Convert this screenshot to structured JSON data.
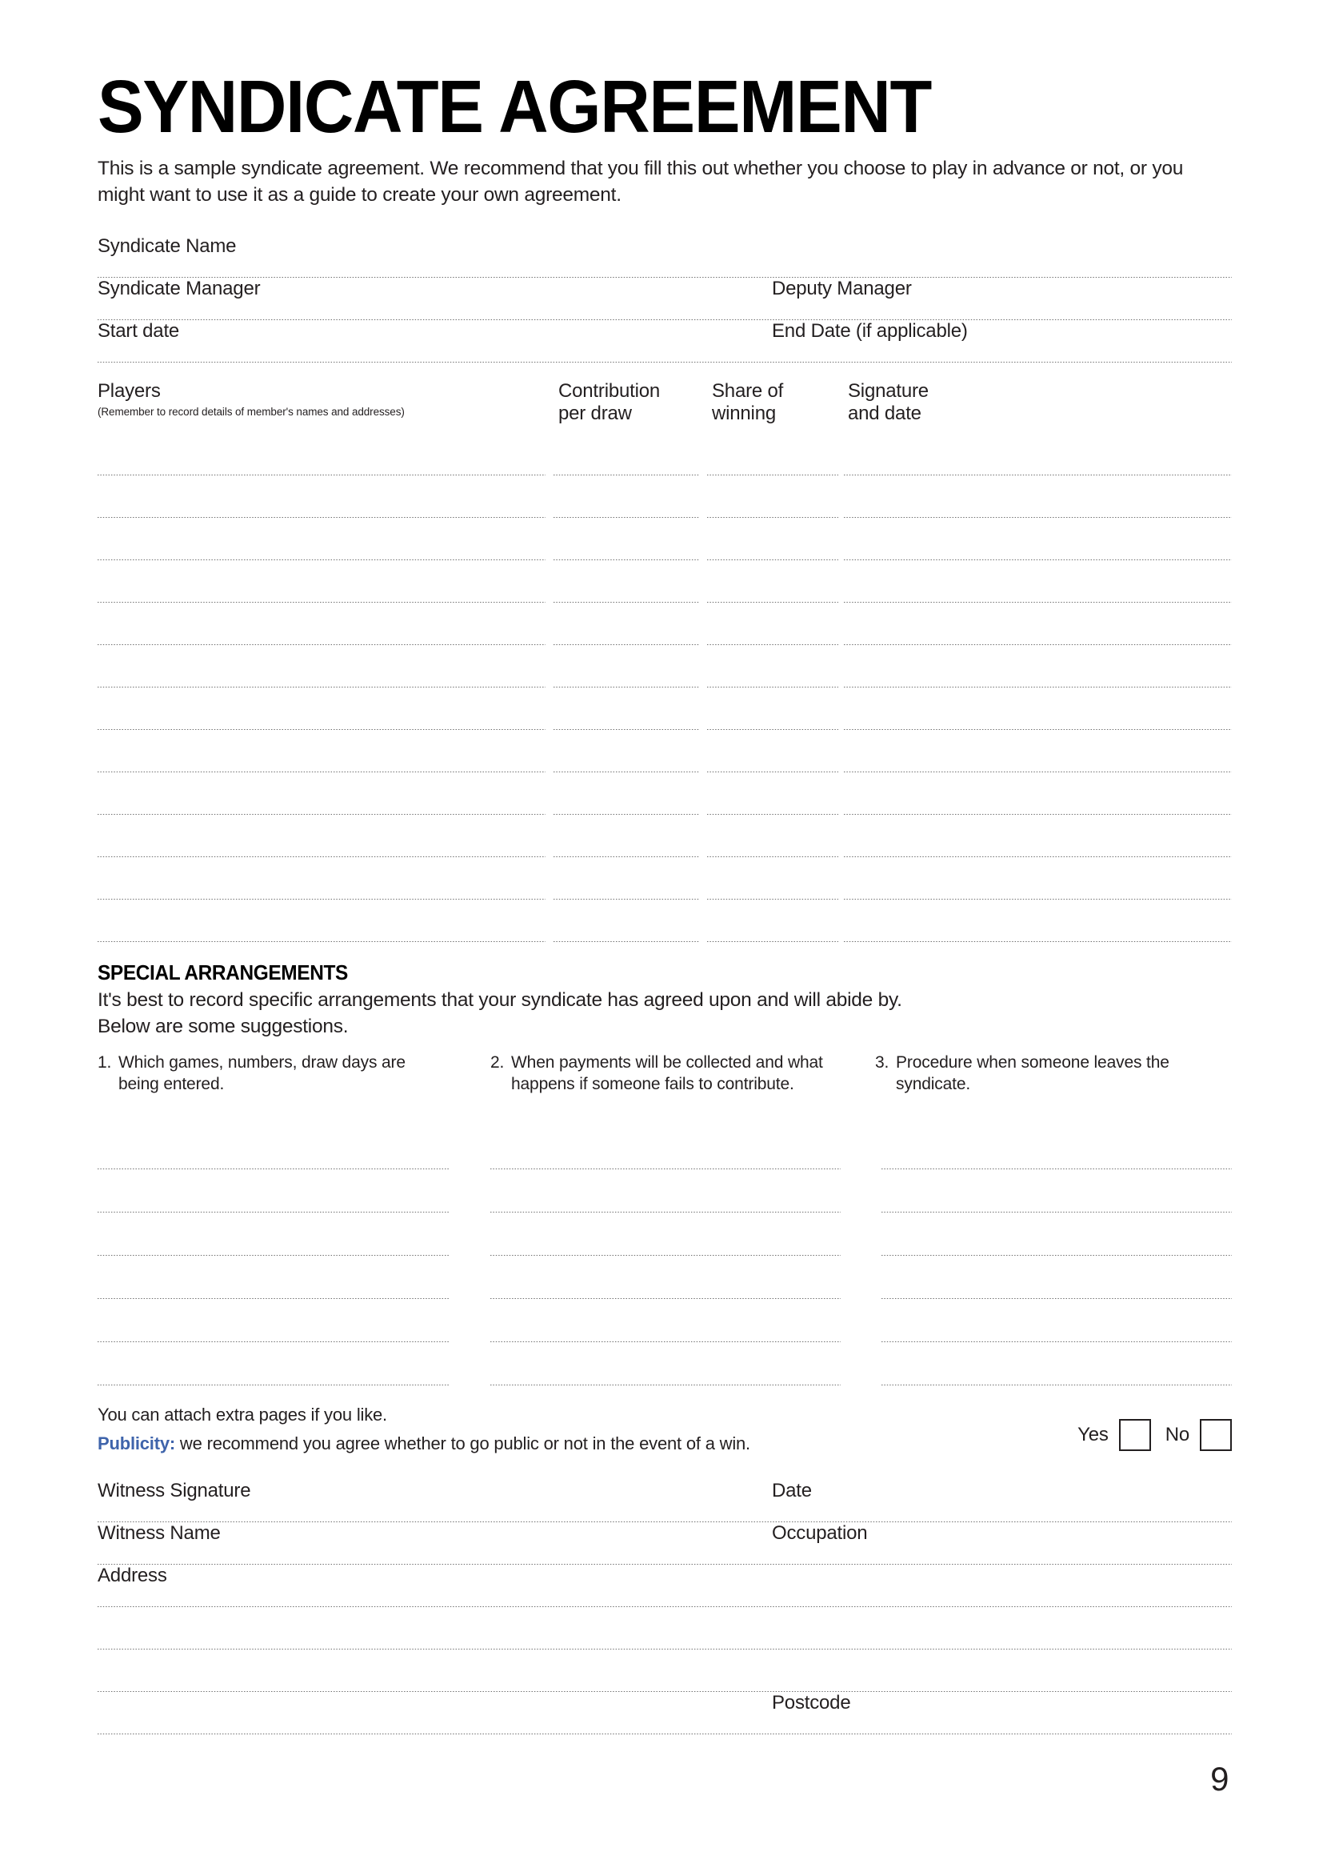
{
  "document": {
    "title": "SYNDICATE AGREEMENT",
    "intro": "This is a sample syndicate agreement. We recommend that you fill this out whether you choose to play in advance or not, or you might want to use it as a guide to create your own agreement.",
    "page_number": "9"
  },
  "identity_fields": [
    {
      "left": "Syndicate Name",
      "right": ""
    },
    {
      "left": "Syndicate Manager",
      "right": "Deputy Manager"
    },
    {
      "left": "Start date",
      "right": "End Date (if applicable)"
    }
  ],
  "players_table": {
    "columns": [
      {
        "title": "Players",
        "note": "(Remember to record details of member's names and addresses)"
      },
      {
        "title": "Contribution\nper draw",
        "note": ""
      },
      {
        "title": "Share of\nwinning",
        "note": ""
      },
      {
        "title": "Signature\nand date",
        "note": ""
      }
    ],
    "column_title_lines": [
      [
        "Players"
      ],
      [
        "Contribution",
        "per draw"
      ],
      [
        "Share of",
        "winning"
      ],
      [
        "Signature",
        "and date"
      ]
    ],
    "row_count": 12,
    "rows": [
      {
        "player": "",
        "contribution": "",
        "share": "",
        "signature": ""
      },
      {
        "player": "",
        "contribution": "",
        "share": "",
        "signature": ""
      },
      {
        "player": "",
        "contribution": "",
        "share": "",
        "signature": ""
      },
      {
        "player": "",
        "contribution": "",
        "share": "",
        "signature": ""
      },
      {
        "player": "",
        "contribution": "",
        "share": "",
        "signature": ""
      },
      {
        "player": "",
        "contribution": "",
        "share": "",
        "signature": ""
      },
      {
        "player": "",
        "contribution": "",
        "share": "",
        "signature": ""
      },
      {
        "player": "",
        "contribution": "",
        "share": "",
        "signature": ""
      },
      {
        "player": "",
        "contribution": "",
        "share": "",
        "signature": ""
      },
      {
        "player": "",
        "contribution": "",
        "share": "",
        "signature": ""
      },
      {
        "player": "",
        "contribution": "",
        "share": "",
        "signature": ""
      },
      {
        "player": "",
        "contribution": "",
        "share": "",
        "signature": ""
      }
    ]
  },
  "special_arrangements": {
    "heading": "SPECIAL ARRANGEMENTS",
    "body_line1": "It's best to record specific arrangements that your syndicate has agreed upon and will abide by.",
    "body_line2": "Below are some suggestions.",
    "suggestions": [
      {
        "number": "1.",
        "text": "Which games, numbers, draw days are being entered."
      },
      {
        "number": "2.",
        "text": "When payments will be collected and what happens if someone fails to contribute."
      },
      {
        "number": "3.",
        "text": "Procedure when someone leaves the syndicate."
      }
    ],
    "writing_line_count": 6
  },
  "attachments": {
    "note": "You can attach extra pages if you like.",
    "publicity_label": "Publicity:",
    "publicity_text": " we recommend you agree whether to go public or not in the event of a win.",
    "publicity_label_color": "#3f64ab",
    "yes_label": "Yes",
    "no_label": "No"
  },
  "witness": {
    "rows": [
      {
        "left": "Witness Signature",
        "right": "Date"
      },
      {
        "left": "Witness Name",
        "right": "Occupation"
      },
      {
        "left": "Address",
        "right": ""
      }
    ],
    "address_blank_lines": 2,
    "postcode_label": "Postcode"
  }
}
